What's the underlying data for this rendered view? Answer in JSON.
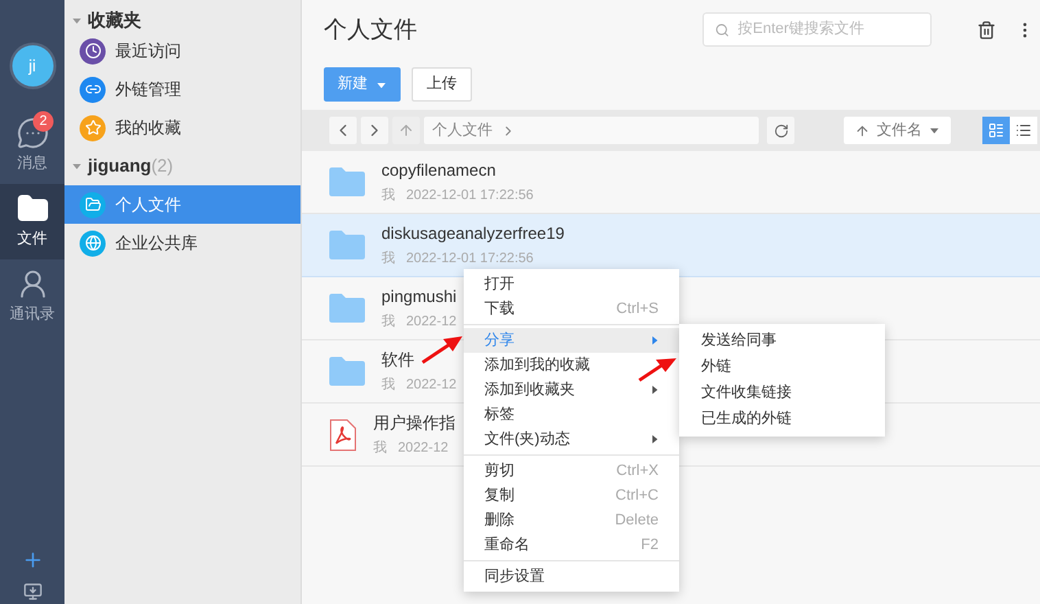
{
  "rail": {
    "avatar": "ji",
    "items": [
      {
        "label": "消息",
        "badge": "2",
        "kind": "chat",
        "selected": false
      },
      {
        "label": "文件",
        "kind": "folder",
        "selected": true
      },
      {
        "label": "通讯录",
        "kind": "contacts",
        "selected": false
      }
    ]
  },
  "sidebar": {
    "favorites": {
      "title": "收藏夹",
      "expanded": true,
      "items": [
        {
          "label": "最近访问",
          "kind": "recent",
          "color": "#6a4fa8"
        },
        {
          "label": "外链管理",
          "kind": "link",
          "color": "#1e88f0"
        },
        {
          "label": "我的收藏",
          "kind": "star",
          "color": "#f7a21b"
        }
      ]
    },
    "group": {
      "title": "jiguang",
      "count": "(2)",
      "expanded": true,
      "items": [
        {
          "label": "个人文件",
          "kind": "folder",
          "selected": true
        },
        {
          "label": "企业公共库",
          "kind": "globe",
          "selected": false
        }
      ]
    }
  },
  "header": {
    "title": "个人文件",
    "search": {
      "placeholder": "按Enter键搜索文件"
    }
  },
  "toolbar": {
    "new_button": "新建",
    "upload_button": "上传"
  },
  "navbar": {
    "path": "个人文件",
    "sort": "文件名",
    "views": [
      {
        "kind": "detail",
        "selected": true
      },
      {
        "kind": "list",
        "selected": false
      }
    ]
  },
  "files": [
    {
      "name": "copyfilenamecn",
      "owner": "我",
      "date": "2022-12-01 17:22:56",
      "kind": "folder",
      "selected": false
    },
    {
      "name": "diskusageanalyzerfree19",
      "owner": "我",
      "date": "2022-12-01 17:22:56",
      "kind": "folder",
      "selected": true
    },
    {
      "name": "pingmushi",
      "owner": "我",
      "date": "2022-12",
      "kind": "folder",
      "selected": false
    },
    {
      "name": "软件",
      "owner": "我",
      "date": "2022-12",
      "kind": "folder",
      "selected": false
    },
    {
      "name": "用户操作指",
      "owner": "我",
      "date": "2022-12",
      "kind": "pdf",
      "selected": false
    }
  ],
  "context_menu": {
    "groups": [
      [
        {
          "label": "打开",
          "selected": false,
          "submenu": false
        },
        {
          "label": "下载",
          "shortcut": "Ctrl+S",
          "selected": false,
          "submenu": false
        }
      ],
      [
        {
          "label": "分享",
          "selected": true,
          "submenu": true
        },
        {
          "label": "添加到我的收藏",
          "selected": false,
          "submenu": false
        },
        {
          "label": "添加到收藏夹",
          "selected": false,
          "submenu": true
        },
        {
          "label": "标签",
          "selected": false,
          "submenu": false
        },
        {
          "label": "文件(夹)动态",
          "selected": false,
          "submenu": true
        }
      ],
      [
        {
          "label": "剪切",
          "shortcut": "Ctrl+X",
          "selected": false,
          "submenu": false
        },
        {
          "label": "复制",
          "shortcut": "Ctrl+C",
          "selected": false,
          "submenu": false
        },
        {
          "label": "删除",
          "shortcut": "Delete",
          "selected": false,
          "submenu": false
        },
        {
          "label": "重命名",
          "shortcut": "F2",
          "selected": false,
          "submenu": false
        }
      ],
      [
        {
          "label": "同步设置",
          "selected": false,
          "submenu": false
        }
      ]
    ]
  },
  "submenu": {
    "items": [
      "发送给同事",
      "外链",
      "文件收集链接",
      "已生成的外链"
    ]
  }
}
